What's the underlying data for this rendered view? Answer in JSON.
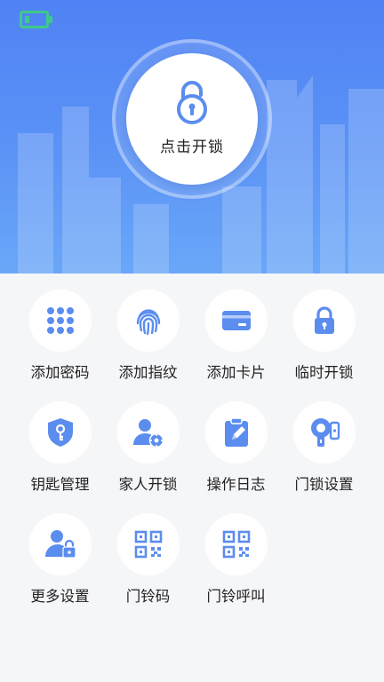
{
  "colors": {
    "accent": "#5b8def",
    "battery": "#3ec98a",
    "header_top": "#4f82f4",
    "header_bottom": "#6aa7f8"
  },
  "unlock": {
    "label": "点击开锁",
    "icon": "padlock-open-icon"
  },
  "status": {
    "battery_icon": "battery-icon"
  },
  "menu": [
    {
      "label": "添加密码",
      "icon": "keypad-icon"
    },
    {
      "label": "添加指纹",
      "icon": "fingerprint-icon"
    },
    {
      "label": "添加卡片",
      "icon": "card-icon"
    },
    {
      "label": "临时开锁",
      "icon": "padlock-icon"
    },
    {
      "label": "钥匙管理",
      "icon": "key-shield-icon"
    },
    {
      "label": "家人开锁",
      "icon": "user-gear-icon"
    },
    {
      "label": "操作日志",
      "icon": "clipboard-edit-icon"
    },
    {
      "label": "门锁设置",
      "icon": "lock-device-icon"
    },
    {
      "label": "更多设置",
      "icon": "user-lock-icon"
    },
    {
      "label": "门铃码",
      "icon": "qr-code-icon"
    },
    {
      "label": "门铃呼叫",
      "icon": "qr-code-call-icon"
    }
  ]
}
